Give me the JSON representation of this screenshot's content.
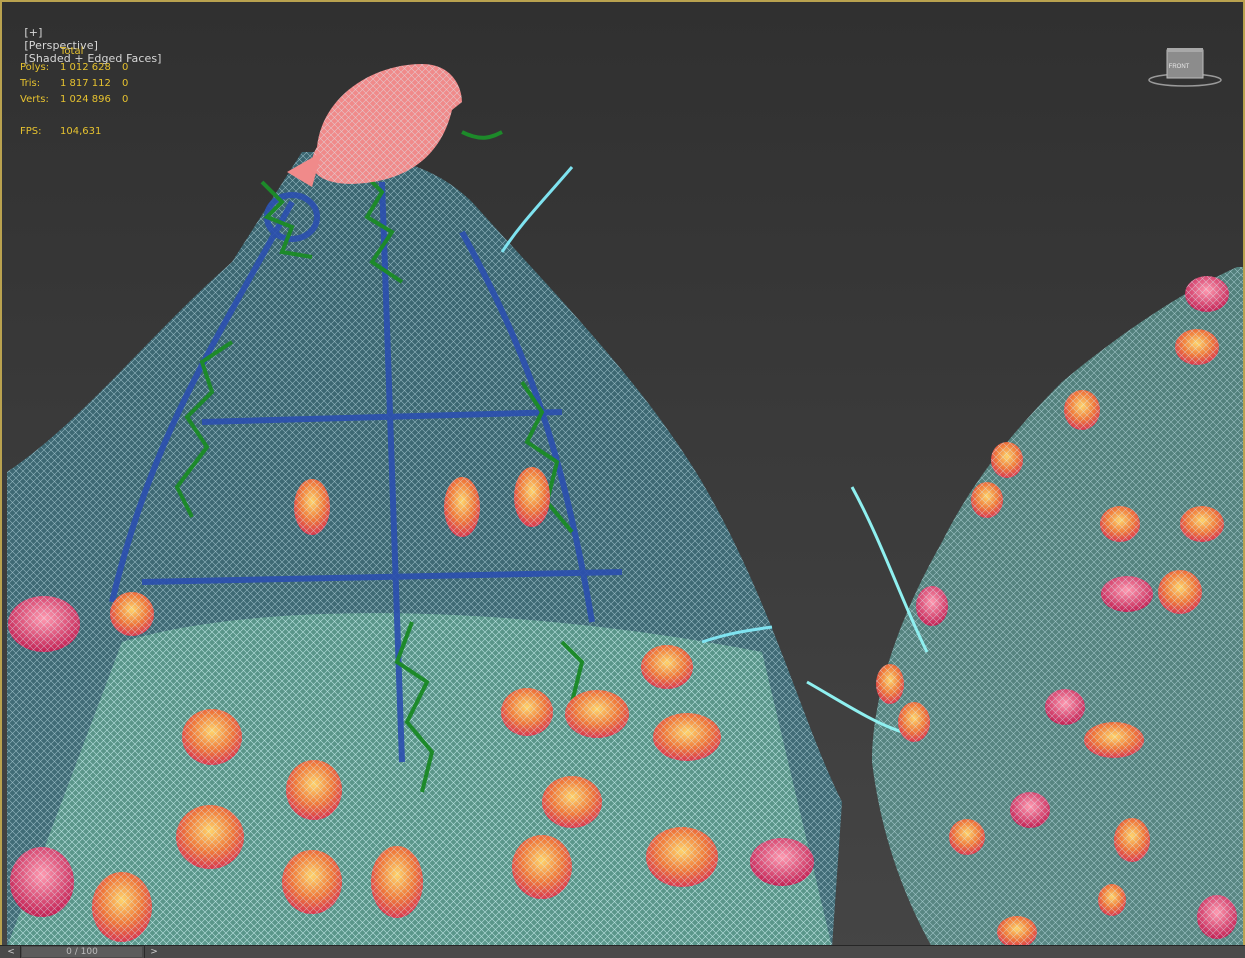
{
  "viewport": {
    "label_plus": "[+]",
    "label_view": "[Perspective]",
    "label_mode": "[Shaded + Edged Faces]"
  },
  "stats": {
    "header": "Total",
    "polys_label": "Polys:",
    "polys_value": "1 012 628",
    "polys_sel": "0",
    "tris_label": "Tris:",
    "tris_value": "1 817 112",
    "tris_sel": "0",
    "verts_label": "Verts:",
    "verts_value": "1 024 896",
    "verts_sel": "0",
    "fps_label": "FPS:",
    "fps_value": "104,631"
  },
  "viewcube": {
    "face_label": "FRONT"
  },
  "time_slider": {
    "prev": "<",
    "position": "0 / 100",
    "next": ">"
  },
  "colors": {
    "viewport_border": "#b9a24f",
    "stats_text": "#e6c22f",
    "leaf_wire": "#7fe3f0",
    "tulip_red": "#e0445a",
    "tulip_orange": "#f08a3a",
    "bird_pink": "#f08a8a",
    "frame_blue": "#2b4fb0",
    "vine_green": "#1d8a2a"
  },
  "icons": {
    "viewcube": "viewcube-icon"
  }
}
